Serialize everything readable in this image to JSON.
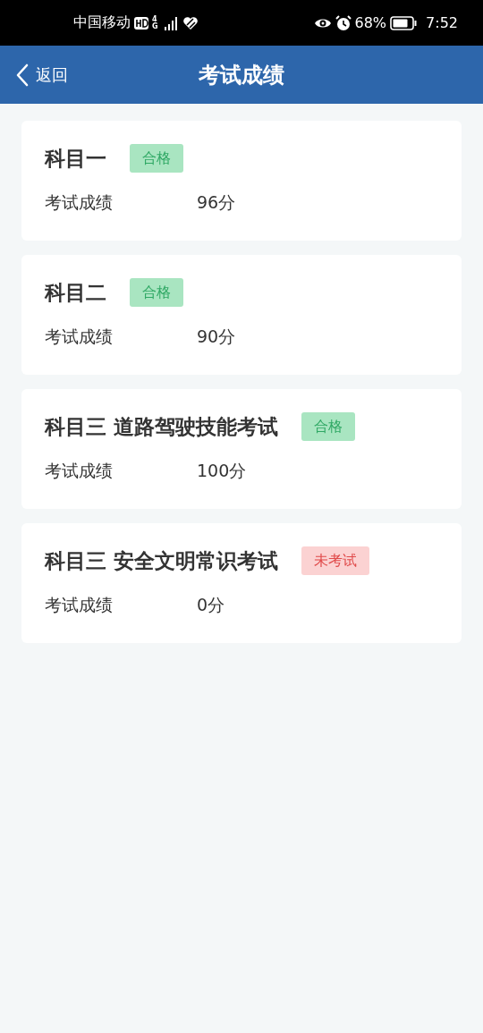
{
  "status_bar": {
    "carrier": "中国移动",
    "network": "4G",
    "battery": "68%",
    "time": "7:52"
  },
  "app_bar": {
    "back": "返回",
    "title": "考试成绩"
  },
  "subjects": [
    {
      "title": "科目一",
      "badge": "合格",
      "kind": "passed",
      "label": "考试成绩",
      "score": "96分"
    },
    {
      "title": "科目二",
      "badge": "合格",
      "kind": "passed",
      "label": "考试成绩",
      "score": "90分"
    },
    {
      "title": "科目三 道路驾驶技能考试",
      "badge": "合格",
      "kind": "passed",
      "label": "考试成绩",
      "score": "100分"
    },
    {
      "title": "科目三 安全文明常识考试",
      "badge": "未考试",
      "kind": "not_taken",
      "label": "考试成绩",
      "score": "0分"
    }
  ]
}
